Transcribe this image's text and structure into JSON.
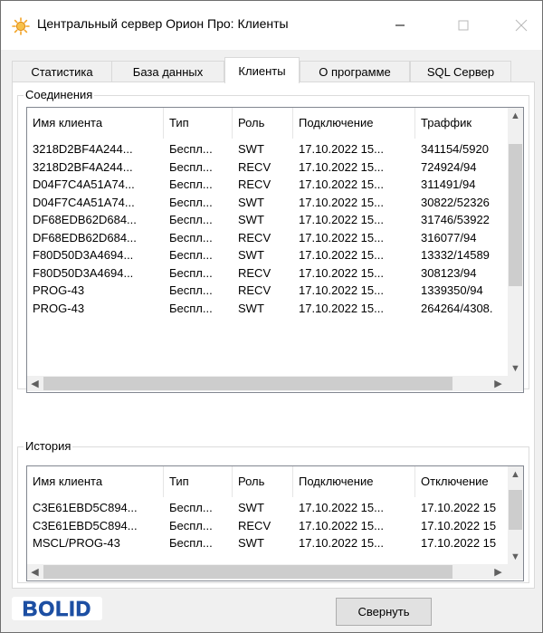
{
  "window": {
    "title": "Центральный сервер Орион Про: Клиенты",
    "accent_color": "#f3a425"
  },
  "tabs": [
    {
      "label": "Статистика",
      "active": false
    },
    {
      "label": "База данных",
      "active": false
    },
    {
      "label": "Клиенты",
      "active": true
    },
    {
      "label": "О программе",
      "active": false
    },
    {
      "label": "SQL Сервер",
      "active": false
    }
  ],
  "connections": {
    "group_title": "Соединения",
    "headers": [
      "Имя клиента",
      "Тип",
      "Роль",
      "Подключение",
      "Траффик"
    ],
    "rows": [
      [
        "3218D2BF4A244...",
        "Беспл...",
        "SWT",
        "17.10.2022 15...",
        "341154/5920"
      ],
      [
        "3218D2BF4A244...",
        "Беспл...",
        "RECV",
        "17.10.2022 15...",
        "724924/94"
      ],
      [
        "D04F7C4A51A74...",
        "Беспл...",
        "RECV",
        "17.10.2022 15...",
        "311491/94"
      ],
      [
        "D04F7C4A51A74...",
        "Беспл...",
        "SWT",
        "17.10.2022 15...",
        "30822/52326"
      ],
      [
        "DF68EDB62D684...",
        "Беспл...",
        "SWT",
        "17.10.2022 15...",
        "31746/53922"
      ],
      [
        "DF68EDB62D684...",
        "Беспл...",
        "RECV",
        "17.10.2022 15...",
        "316077/94"
      ],
      [
        "F80D50D3A4694...",
        "Беспл...",
        "SWT",
        "17.10.2022 15...",
        "13332/14589"
      ],
      [
        "F80D50D3A4694...",
        "Беспл...",
        "RECV",
        "17.10.2022 15...",
        "308123/94"
      ],
      [
        "PROG-43",
        "Беспл...",
        "RECV",
        "17.10.2022 15...",
        "1339350/94"
      ],
      [
        "PROG-43",
        "Беспл...",
        "SWT",
        "17.10.2022 15...",
        "264264/4308."
      ]
    ]
  },
  "history": {
    "group_title": "История",
    "headers": [
      "Имя клиента",
      "Тип",
      "Роль",
      "Подключение",
      "Отключение"
    ],
    "rows": [
      [
        "C3E61EBD5C894...",
        "Беспл...",
        "SWT",
        "17.10.2022 15...",
        "17.10.2022 15"
      ],
      [
        "C3E61EBD5C894...",
        "Беспл...",
        "RECV",
        "17.10.2022 15...",
        "17.10.2022 15"
      ],
      [
        "MSCL/PROG-43",
        "Беспл...",
        "SWT",
        "17.10.2022 15...",
        "17.10.2022 15"
      ]
    ]
  },
  "logo_text": "BOLID",
  "collapse_button_label": "Свернуть"
}
